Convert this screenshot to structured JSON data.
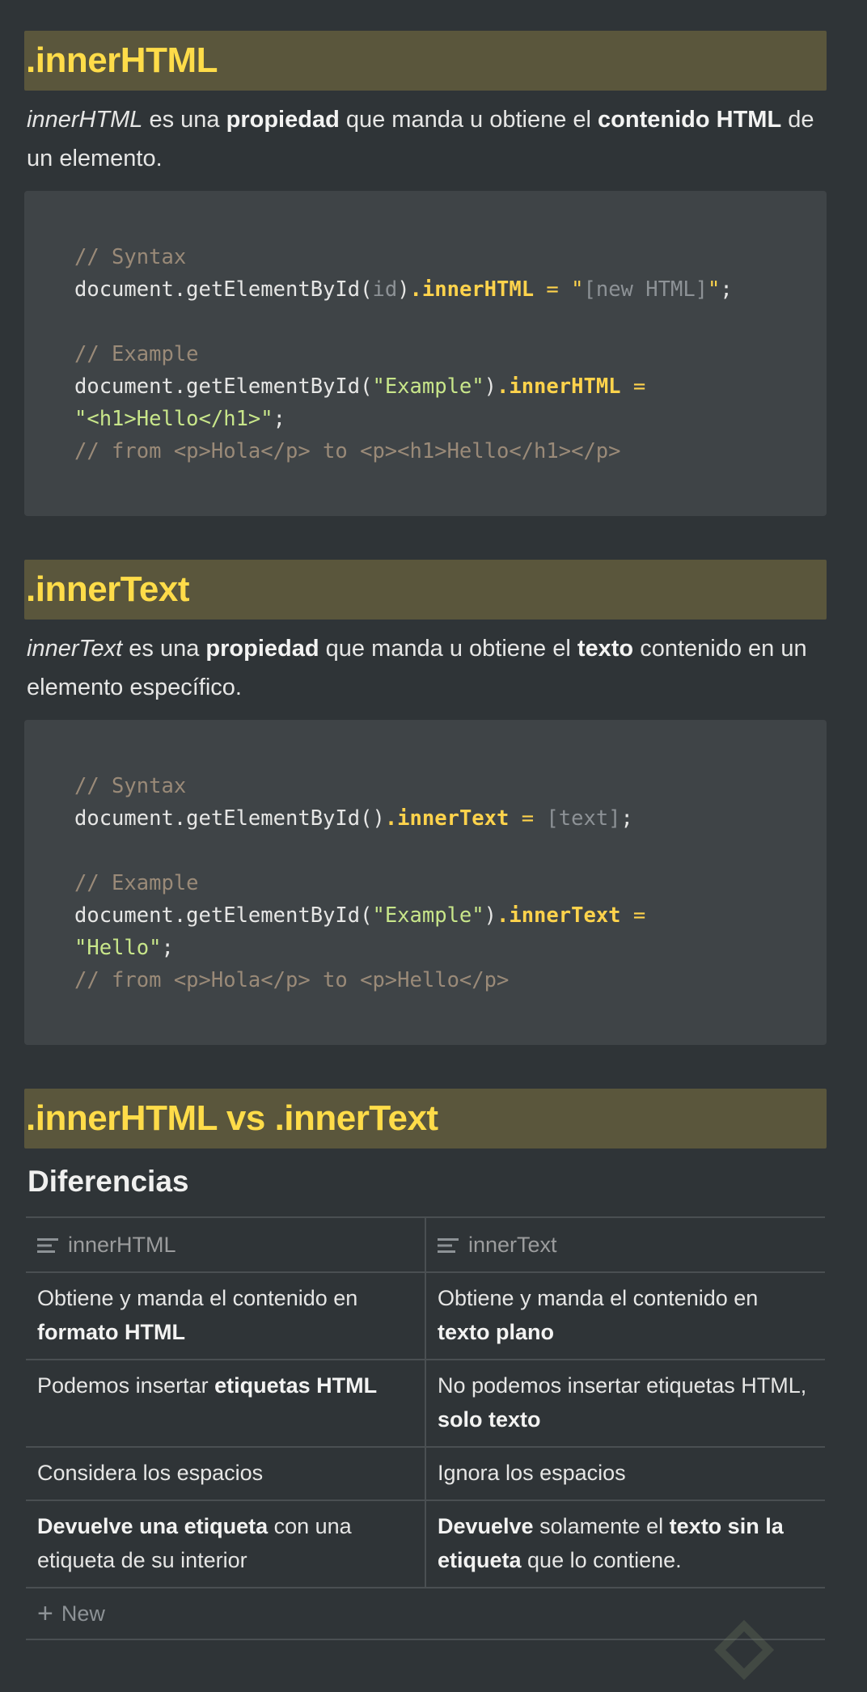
{
  "sections": [
    {
      "title": ".innerHTML",
      "description": {
        "subject": "innerHTML",
        "t1": " es una ",
        "b1": "propiedad",
        "t2": " que manda u obtiene el ",
        "b2": "contenido HTML",
        "t3": " de un elemento."
      },
      "code": {
        "syntax_comment": "// Syntax",
        "syntax_obj": "document.getElementById(",
        "syntax_arg": "id",
        "syntax_close": ")",
        "syntax_prop": ".innerHTML",
        "syntax_eq": " = ",
        "syntax_q1": "\"",
        "syntax_val": "[new HTML]",
        "syntax_q2": "\"",
        "syntax_end": ";",
        "example_comment": "// Example",
        "example_obj": "document.getElementById(",
        "example_arg": "\"Example\"",
        "example_close": ")",
        "example_prop": ".innerHTML",
        "example_eq": " =",
        "example_val": "\"<h1>Hello</h1>\"",
        "example_end": ";",
        "result_comment": "// from <p>Hola</p> to <p><h1>Hello</h1></p>"
      }
    },
    {
      "title": ".innerText",
      "description": {
        "subject": "innerText",
        "t1": " es una ",
        "b1": "propiedad",
        "t2": " que manda u obtiene el ",
        "b2": "texto",
        "t3": " contenido en un elemento específico."
      },
      "code": {
        "syntax_comment": "// Syntax",
        "syntax_obj": "document.getElementById(",
        "syntax_close": ")",
        "syntax_prop": ".innerText",
        "syntax_eq": " = ",
        "syntax_val": "[text]",
        "syntax_end": ";",
        "example_comment": "// Example",
        "example_obj": "document.getElementById(",
        "example_arg": "\"Example\"",
        "example_close": ")",
        "example_prop": ".innerText",
        "example_eq": " =",
        "example_val": "\"Hello\"",
        "example_end": ";",
        "result_comment": "// from <p>Hola</p> to <p>Hello</p>"
      }
    }
  ],
  "comparison": {
    "title": ".innerHTML vs .innerText",
    "subtitle": "Diferencias",
    "columns": [
      "innerHTML",
      "innerText"
    ],
    "column_icon": "text-lines-icon",
    "rows": [
      {
        "a": {
          "t1": "Obtiene y manda el contenido en ",
          "b1": "formato HTML",
          "t2": ""
        },
        "b": {
          "t1": "Obtiene y manda el contenido en ",
          "b1": "texto plano",
          "t2": ""
        }
      },
      {
        "a": {
          "t1": "Podemos insertar ",
          "b1": "etiquetas HTML",
          "t2": ""
        },
        "b": {
          "t1": "No podemos insertar etiquetas HTML, ",
          "b1": "solo texto",
          "t2": ""
        }
      },
      {
        "a": {
          "t1": "Considera los espacios",
          "b1": "",
          "t2": ""
        },
        "b": {
          "t1": "Ignora los espacios",
          "b1": "",
          "t2": ""
        }
      },
      {
        "a": {
          "t1": "",
          "b1": "Devuelve una etiqueta",
          "t2": " con una etiqueta de su interior"
        },
        "b": {
          "t1": "",
          "b1": "Devuelve",
          "t2": " solamente el ",
          "b2": "texto sin la etiqueta",
          "t3": " que lo contiene."
        }
      }
    ],
    "new_label": "New"
  },
  "colors": {
    "background": "#2f3437",
    "heading_bg": "#5a563c",
    "heading_text": "#ffdc49",
    "code_bg": "#3f4447"
  }
}
